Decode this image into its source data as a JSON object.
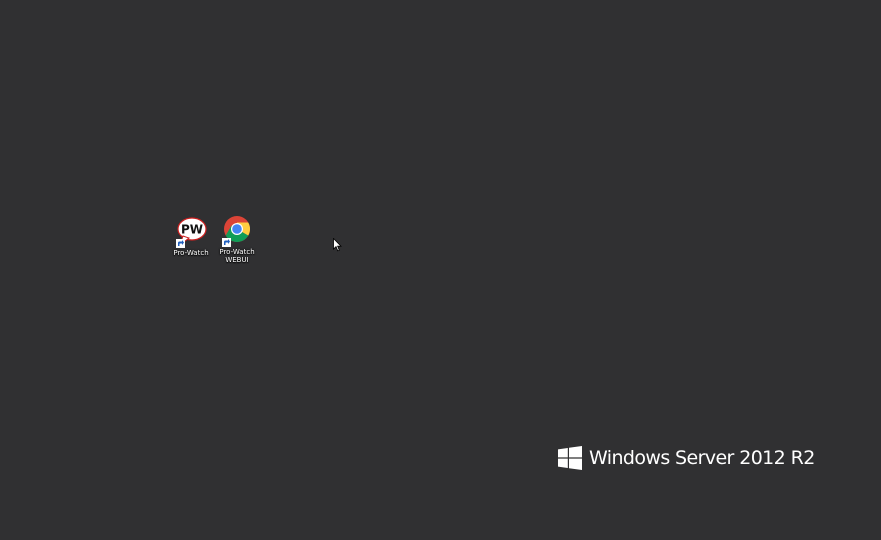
{
  "desktop": {
    "background_color": "#303032",
    "icons": [
      {
        "label": "Pro-Watch",
        "icon": "prowatch-app-icon"
      },
      {
        "label_line1": "Pro-Watch",
        "label_line2": "WEBUI",
        "icon": "chrome-icon"
      }
    ]
  },
  "branding": {
    "text": "Windows Server 2012 R2",
    "logo": "windows-logo-icon"
  }
}
